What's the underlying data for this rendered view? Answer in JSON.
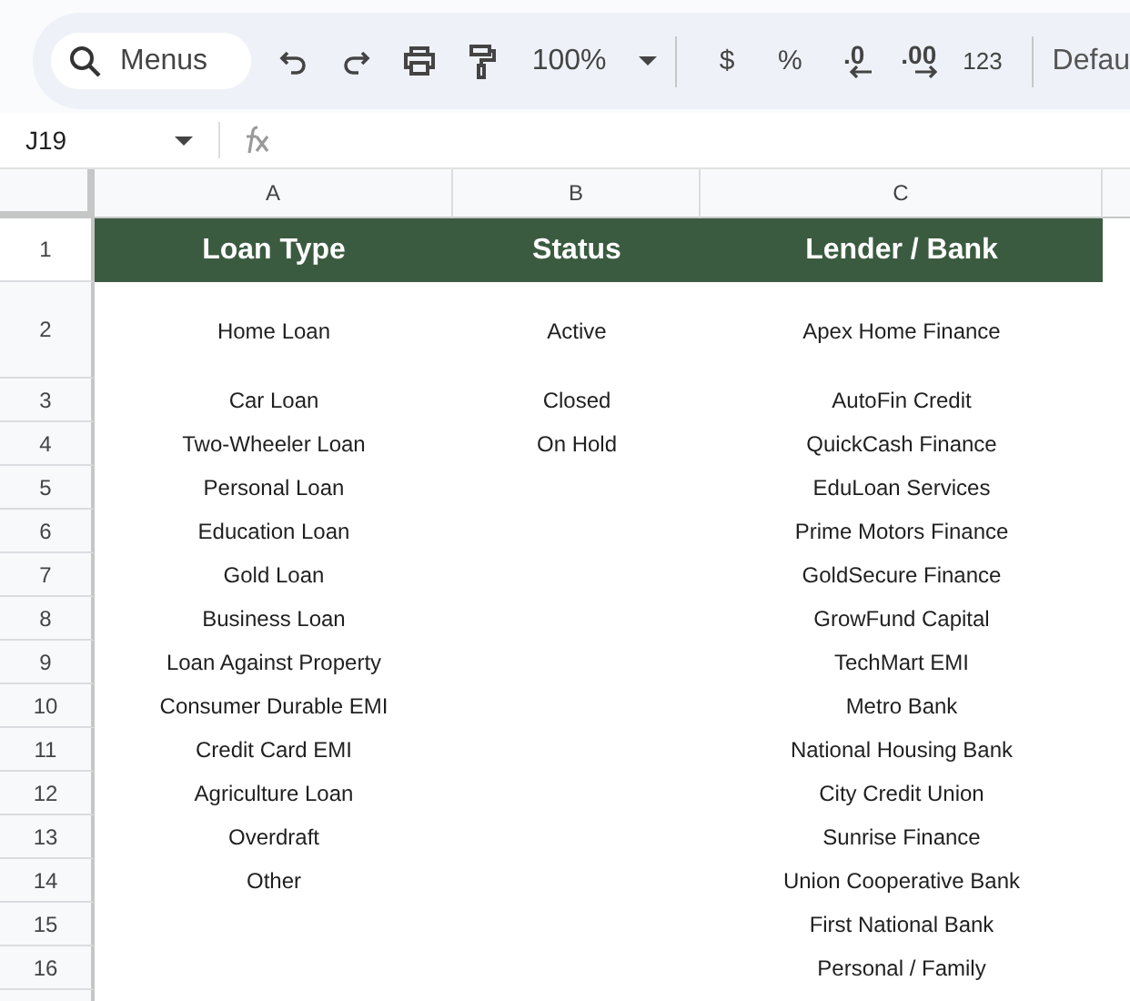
{
  "toolbar": {
    "search": {
      "placeholder": "Menus"
    },
    "zoom": "100%",
    "currency": "$",
    "percent": "%",
    "decrease_decimal": ".0",
    "increase_decimal": ".00",
    "number_format": "123",
    "font": "Defau"
  },
  "name_box": "J19",
  "column_headers": [
    "A",
    "B",
    "C"
  ],
  "header_row": {
    "number": "1",
    "cells": [
      "Loan Type",
      "Status",
      "Lender / Bank"
    ]
  },
  "rows": [
    {
      "number": "2",
      "cells": [
        "Home Loan",
        "Active",
        "Apex Home Finance"
      ]
    },
    {
      "number": "3",
      "cells": [
        "Car Loan",
        "Closed",
        "AutoFin Credit"
      ]
    },
    {
      "number": "4",
      "cells": [
        "Two-Wheeler Loan",
        "On Hold",
        "QuickCash Finance"
      ]
    },
    {
      "number": "5",
      "cells": [
        "Personal Loan",
        "",
        "EduLoan Services"
      ]
    },
    {
      "number": "6",
      "cells": [
        "Education Loan",
        "",
        "Prime Motors Finance"
      ]
    },
    {
      "number": "7",
      "cells": [
        "Gold Loan",
        "",
        "GoldSecure Finance"
      ]
    },
    {
      "number": "8",
      "cells": [
        "Business Loan",
        "",
        "GrowFund Capital"
      ]
    },
    {
      "number": "9",
      "cells": [
        "Loan Against Property",
        "",
        "TechMart EMI"
      ]
    },
    {
      "number": "10",
      "cells": [
        "Consumer Durable EMI",
        "",
        "Metro Bank"
      ]
    },
    {
      "number": "11",
      "cells": [
        "Credit Card EMI",
        "",
        "National Housing Bank"
      ]
    },
    {
      "number": "12",
      "cells": [
        "Agriculture Loan",
        "",
        "City Credit Union"
      ]
    },
    {
      "number": "13",
      "cells": [
        "Overdraft",
        "",
        "Sunrise Finance"
      ]
    },
    {
      "number": "14",
      "cells": [
        "Other",
        "",
        "Union Cooperative Bank"
      ]
    },
    {
      "number": "15",
      "cells": [
        "",
        "",
        "First National Bank"
      ]
    },
    {
      "number": "16",
      "cells": [
        "",
        "",
        "Personal / Family"
      ]
    }
  ]
}
